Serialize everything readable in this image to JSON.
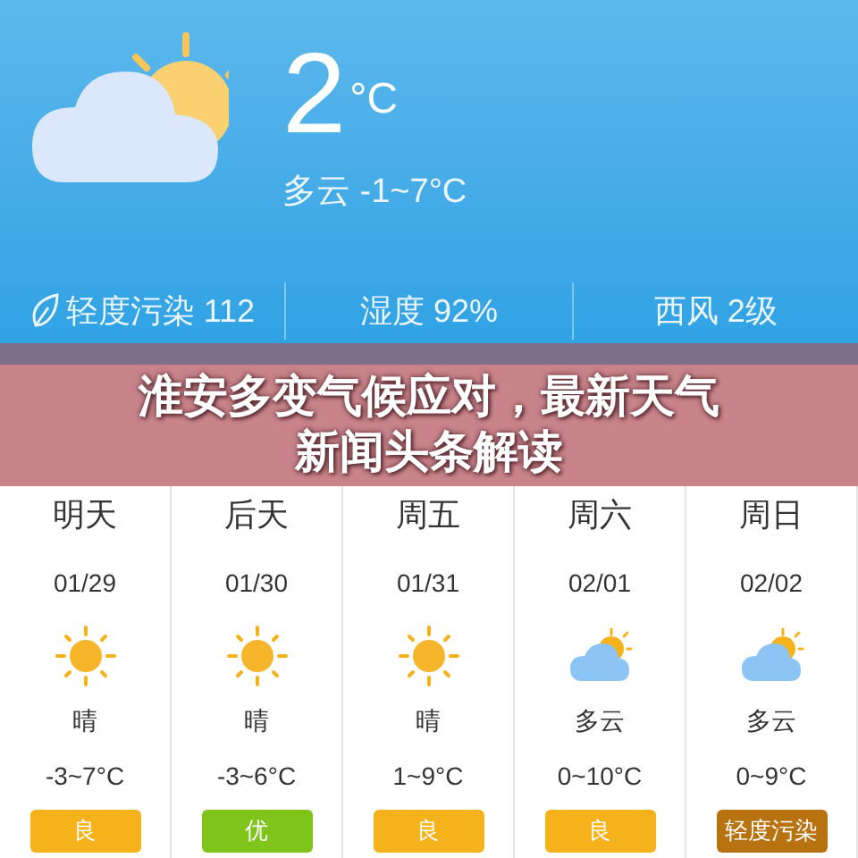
{
  "current": {
    "temperature": "2",
    "unit": "°C",
    "summary": "多云 -1~7°C"
  },
  "stats": [
    {
      "kind": "air",
      "text": "轻度污染 112"
    },
    {
      "kind": "plain",
      "text": "湿度 92%"
    },
    {
      "kind": "plain",
      "text": "西风 2级"
    }
  ],
  "banner": {
    "lines": [
      "淮安多变气候应对，最新天气",
      "新闻头条解读"
    ]
  },
  "forecast": [
    {
      "day": "明天",
      "date": "01/29",
      "kind": "sunny",
      "condition": "晴",
      "range": "-3~7°C",
      "air": "良",
      "color": "#f5b21b"
    },
    {
      "day": "后天",
      "date": "01/30",
      "kind": "sunny",
      "condition": "晴",
      "range": "-3~6°C",
      "air": "优",
      "color": "#7ec41a"
    },
    {
      "day": "周五",
      "date": "01/31",
      "kind": "sunny",
      "condition": "晴",
      "range": "1~9°C",
      "air": "良",
      "color": "#f5b21b"
    },
    {
      "day": "周六",
      "date": "02/01",
      "kind": "cloudy",
      "condition": "多云",
      "range": "0~10°C",
      "air": "良",
      "color": "#f5b21b"
    },
    {
      "day": "周日",
      "date": "02/02",
      "kind": "cloudy",
      "condition": "多云",
      "range": "0~9°C",
      "air": "轻度污染",
      "color": "#b8720f"
    }
  ]
}
